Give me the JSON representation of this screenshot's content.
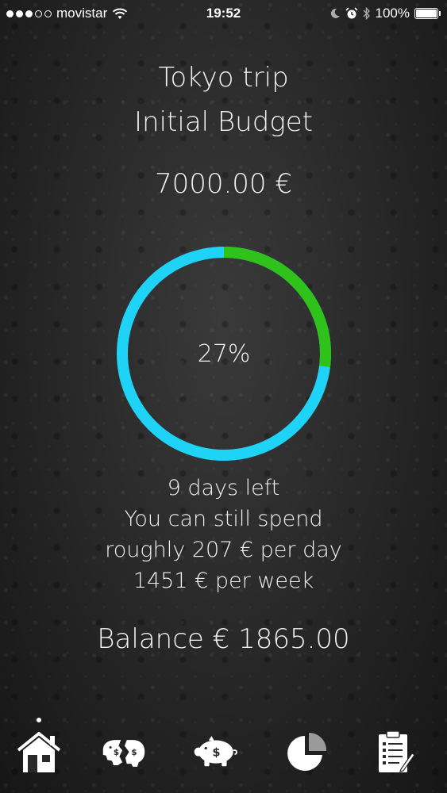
{
  "status_bar": {
    "carrier": "movistar",
    "time": "19:52",
    "battery": "100%",
    "signal_bars_filled": 3,
    "signal_bars_total": 5
  },
  "trip": {
    "title": "Tokyo trip",
    "budget_label": "Initial Budget",
    "budget_amount": "7000.00 €"
  },
  "progress": {
    "percent_label": "27%",
    "spent_fraction": 0.27,
    "colors": {
      "remaining": "#1ed3f5",
      "spent": "#2fc21b"
    }
  },
  "summary": {
    "days_left": "9 days left",
    "spend_line": "You can still spend",
    "per_day": "roughly 207 € per day",
    "per_week": "1451 € per week"
  },
  "balance": "Balance € 1865.00",
  "tab_bar": {
    "active_index": 0,
    "tabs": [
      {
        "icon": "house-icon"
      },
      {
        "icon": "broken-piggy-bank-icon"
      },
      {
        "icon": "piggy-bank-icon"
      },
      {
        "icon": "pie-chart-icon"
      },
      {
        "icon": "checklist-icon"
      }
    ]
  }
}
